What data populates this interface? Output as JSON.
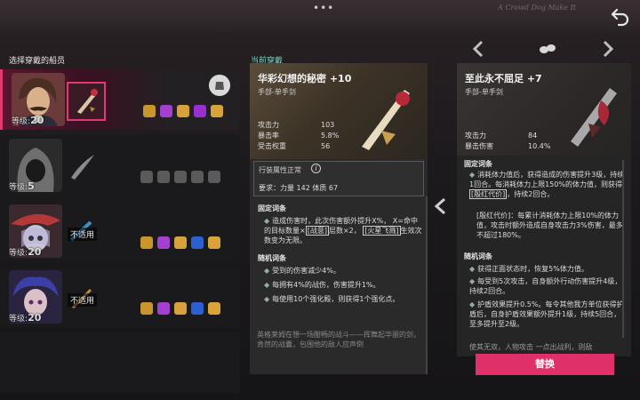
{
  "topbar": {
    "menu_dots": "•••",
    "handwriting": "A Crowd Dog\nMake It"
  },
  "crew_section_title": "选择穿戴的船员",
  "equip_section_title": "当前穿戴",
  "crew": [
    {
      "level_label": "等级",
      "level": "20",
      "unfit": ""
    },
    {
      "level_label": "等级",
      "level": "5",
      "unfit": ""
    },
    {
      "level_label": "等级",
      "level": "20",
      "unfit": "不适用"
    },
    {
      "level_label": "等级",
      "level": "20",
      "unfit": "不适用"
    }
  ],
  "current_weapon": {
    "name": "华彩幻想的秘密 +10",
    "type": "手部-单手剑",
    "stat_labels": [
      "攻击力",
      "暴击率",
      "受击权重"
    ],
    "stat_values": [
      "103",
      "5.8%",
      "56"
    ],
    "req_title": "行装属性正常",
    "req_line": "要求：力量 142 体质 67",
    "fixed_title": "固定词条",
    "fixed_text_1": "造成伤害时，此次伤害额外提升X%，",
    "fixed_text_2": "X=命中的目标数量×",
    "fixed_tag_1": "[战意]",
    "fixed_text_3": "层数×2，",
    "fixed_tag_2": "[火星飞溅]",
    "fixed_text_4": "生效次数变为无限。",
    "random_title": "随机词条",
    "random": [
      "受到的伤害减少4%。",
      "每拥有4%的战伤，伤害提升1%。",
      "每使用10个强化殿，则获得1个强化点。"
    ],
    "lore": "英格莱姆在想一场酣畅的战斗——挥舞起华丽的剑，肯然的战囊，包围他的敌人应声倒"
  },
  "new_weapon": {
    "name": "至此永不屈足 +7",
    "type": "手部-单手剑",
    "stat_labels": [
      "攻击力",
      "暴击伤害"
    ],
    "stat_values": [
      "84",
      "10.4%"
    ],
    "fixed_title": "固定词条",
    "fixed_1": "消耗体力值后，获得造成的伤害提升3级，持续1回合。每消耗体力上限150%的体力值，则获得",
    "fixed_tag": "[殷红代价]",
    "fixed_2": "，持续2回合。",
    "fixed_3": "[殷红代价]：每累计消耗体力上限10%的体力值，攻击时额外造成自身攻击力3%伤害，最多不超过180%。",
    "random_title": "随机词条",
    "random": [
      "获得正面状态时，恢复5%体力值。",
      "每受到5次攻击，自身额外行动伤害提升4级，持续2回合。",
      "护盾效果提升0.5%。每令其他我方单位获得护盾后，自身护盾效果额外提升1级，持续5回合，至多提升至2级。"
    ],
    "cut_text": "使其无双，人物攻击 一点出战利，则敌"
  },
  "swap_button": "替换",
  "colors": {
    "accent": "#e0306a",
    "teal_title": "#7fd1c0"
  }
}
